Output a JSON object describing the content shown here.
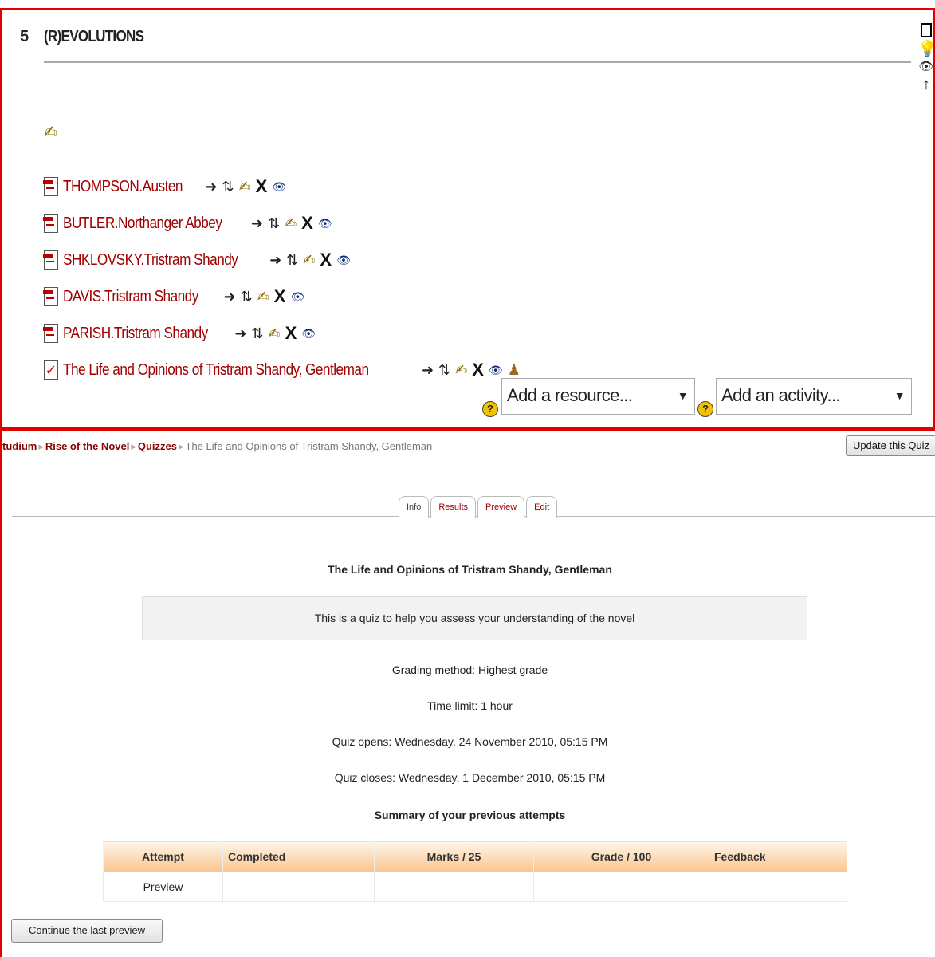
{
  "section": {
    "number": "5",
    "title": "(R)EVOLUTIONS",
    "resources": [
      {
        "label": "THOMPSON.Austen",
        "type": "pdf"
      },
      {
        "label": "BUTLER.Northanger Abbey",
        "type": "pdf"
      },
      {
        "label": "SHKLOVSKY.Tristram Shandy",
        "type": "pdf"
      },
      {
        "label": "DAVIS.Tristram Shandy",
        "type": "pdf"
      },
      {
        "label": "PARISH.Tristram Shandy",
        "type": "pdf"
      },
      {
        "label": "The Life and Opinions of Tristram Shandy, Gentleman",
        "type": "quiz"
      }
    ],
    "add_resource_placeholder": "Add a resource...",
    "add_activity_placeholder": "Add an activity..."
  },
  "breadcrumb": {
    "root": "tudium",
    "course": "Rise of the Novel",
    "module": "Quizzes",
    "current": "The Life and Opinions of Tristram Shandy, Gentleman"
  },
  "update_button": "Update this Quiz",
  "tabs": [
    "Info",
    "Results",
    "Preview",
    "Edit"
  ],
  "quiz": {
    "title": "The Life and Opinions of Tristram Shandy, Gentleman",
    "intro": "This is a quiz to help you assess your understanding of the novel",
    "grading_method": "Grading method: Highest grade",
    "time_limit": "Time limit: 1 hour",
    "opens": "Quiz opens: Wednesday, 24 November 2010, 05:15 PM",
    "closes": "Quiz closes: Wednesday, 1 December 2010, 05:15 PM",
    "summary_title": "Summary of your previous attempts"
  },
  "attempts_table": {
    "headers": [
      "Attempt",
      "Completed",
      "Marks / 25",
      "Grade / 100",
      "Feedback"
    ],
    "rows": [
      [
        "Preview",
        "",
        "",
        "",
        ""
      ]
    ]
  },
  "continue_button": "Continue the last preview",
  "colors": {
    "border_red": "#e00000",
    "link_red": "#a00000",
    "table_header": "#f9c58e"
  }
}
